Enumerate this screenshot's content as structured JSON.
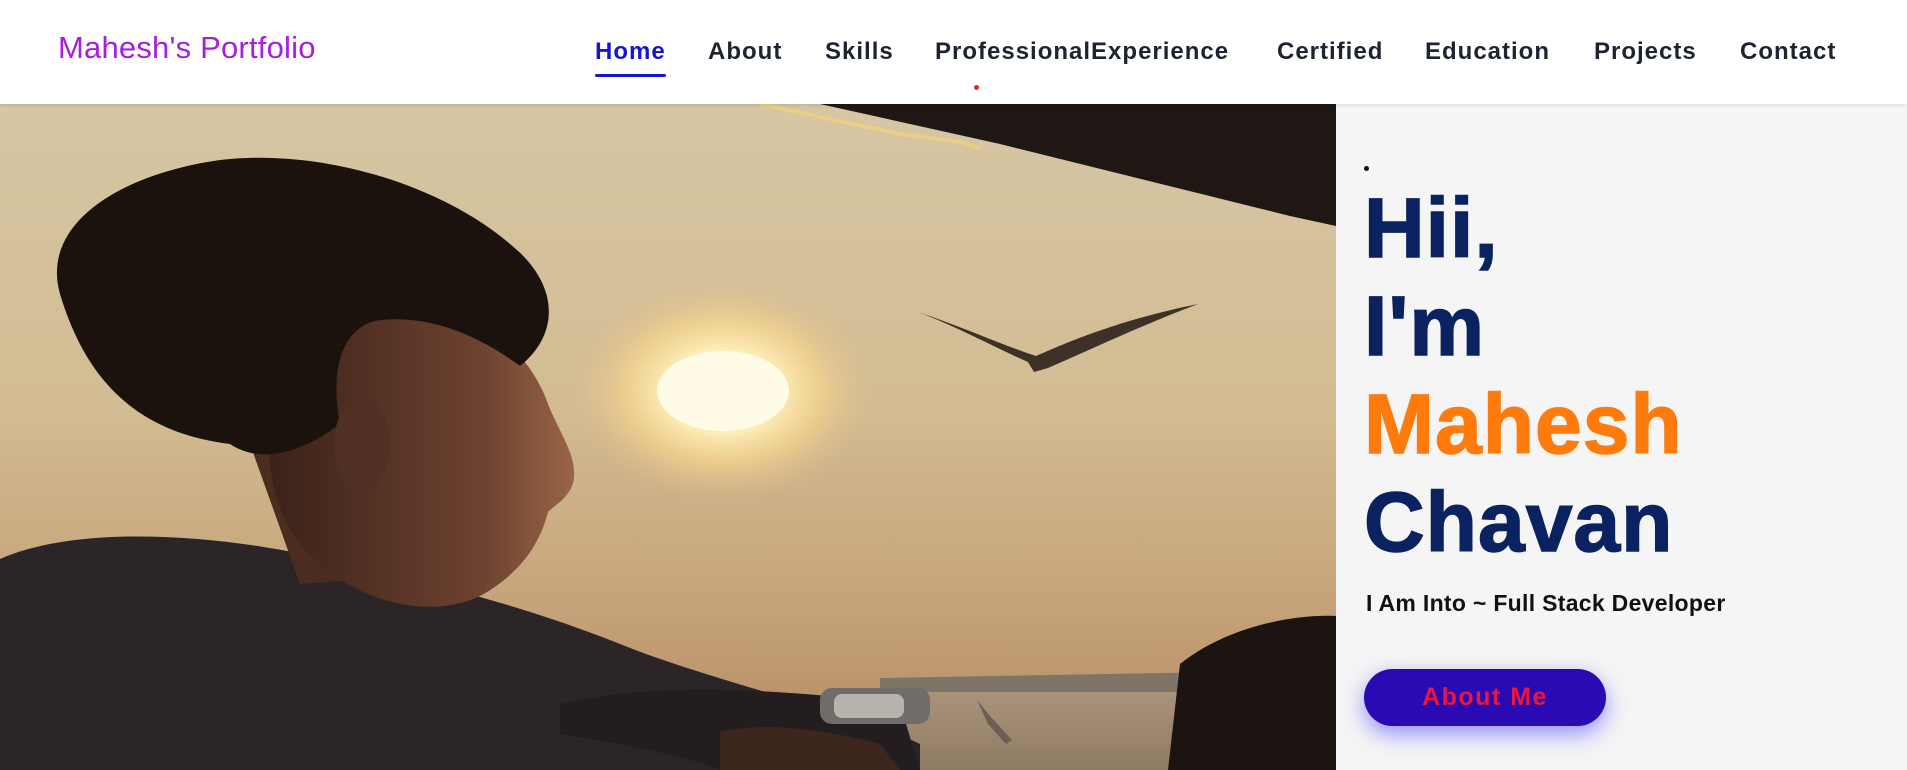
{
  "header": {
    "brand": "Mahesh's Portfolio",
    "nav": [
      {
        "label": "Home",
        "active": true
      },
      {
        "label": "About",
        "active": false
      },
      {
        "label": "Skills",
        "active": false
      },
      {
        "label": "ProfessionalExperience",
        "active": false
      },
      {
        "label": "Certified",
        "active": false
      },
      {
        "label": "Education",
        "active": false
      },
      {
        "label": "Projects",
        "active": false
      },
      {
        "label": "Contact",
        "active": false
      }
    ]
  },
  "hero": {
    "greeting_line1": "Hii,",
    "greeting_line2": "I'm",
    "first_name": "Mahesh",
    "last_name": "Chavan",
    "subtitle": "I Am Into ~ Full Stack Developer",
    "cta_label": "About Me",
    "photo_icon": "profile-photo-sunset"
  },
  "colors": {
    "brand": "#a41fe0",
    "nav_active": "#1516d1",
    "heading": "#0b2260",
    "name_accent": "#ff7b0c",
    "cta_bg": "#2a0ab3",
    "cta_text": "#e8173d"
  }
}
